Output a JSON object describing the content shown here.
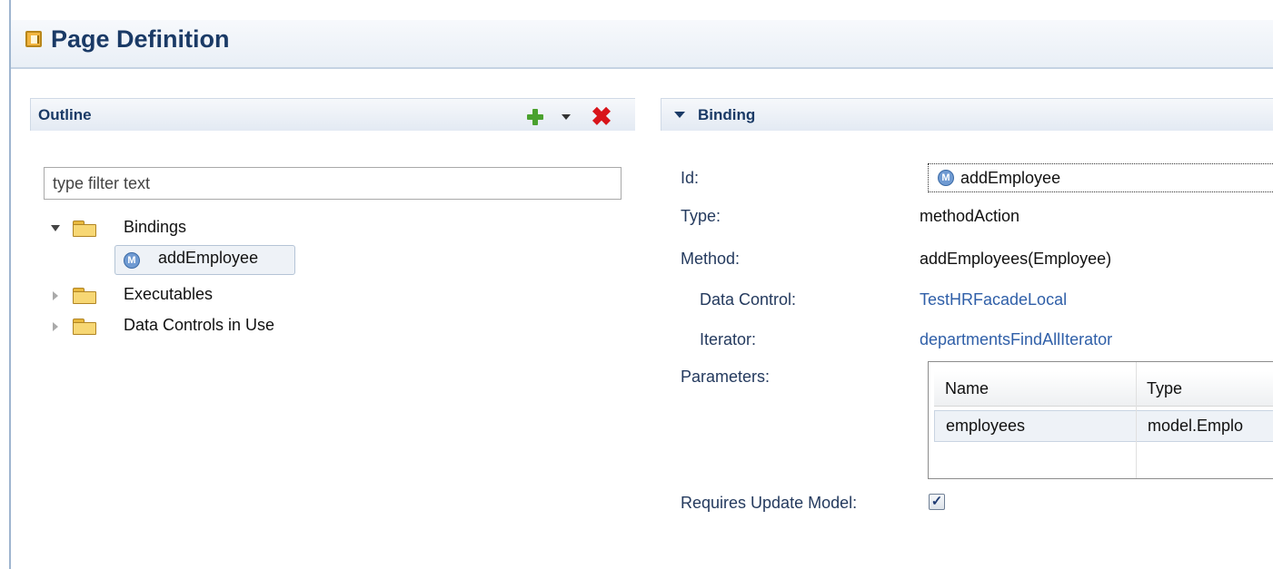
{
  "header": {
    "title": "Page Definition",
    "icon": "page-definition-icon"
  },
  "outline": {
    "title": "Outline",
    "filter_placeholder": "type filter text",
    "tree": {
      "bindings": "Bindings",
      "add_employee": "addEmployee",
      "executables": "Executables",
      "data_controls": "Data Controls in Use"
    },
    "method_glyph": "M"
  },
  "binding": {
    "title": "Binding",
    "id_label": "Id:",
    "id_value": "addEmployee",
    "type_label": "Type:",
    "type_value": "methodAction",
    "method_label": "Method:",
    "method_value": "addEmployees(Employee)",
    "data_control_label": "Data Control:",
    "data_control_value": "TestHRFacadeLocal",
    "iterator_label": "Iterator:",
    "iterator_value": "departmentsFindAllIterator",
    "parameters_label": "Parameters:",
    "parameters": {
      "columns": [
        "Name",
        "Type"
      ],
      "rows": [
        [
          "employees",
          "model.Emplo"
        ]
      ]
    },
    "requires_update_label": "Requires Update Model:",
    "requires_update_checked": true,
    "check_glyph": "✓"
  },
  "colors": {
    "title_blue": "#1a3a66",
    "link_blue": "#2f5fa8",
    "delete_red": "#d8141a",
    "add_green": "#4aa12e"
  }
}
